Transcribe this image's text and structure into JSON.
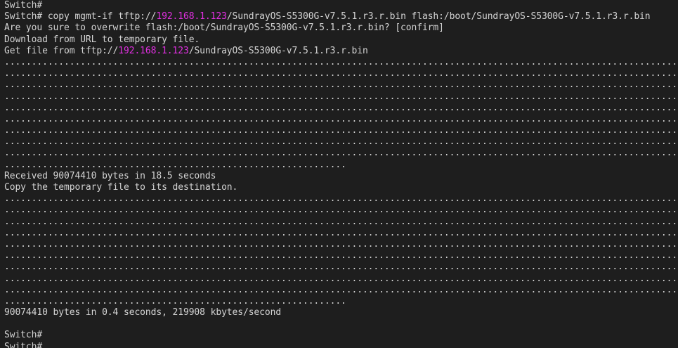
{
  "terminal": {
    "text_color": "#d4d4d4",
    "background_color": "#1e1e1e",
    "highlight_color": "#e22fe2",
    "lines": [
      [
        "Switch#"
      ],
      [
        "Switch# copy mgmt-if tftp://",
        {
          "hl": "192.168.1.123"
        },
        "/SundrayOS-S5300G-v7.5.1.r3.r.bin flash:/boot/SundrayOS-S5300G-v7.5.1.r3.r.bin"
      ],
      [
        "Are you sure to overwrite flash:/boot/SundrayOS-S5300G-v7.5.1.r3.r.bin? [confirm]"
      ],
      [
        "Download from URL to temporary file."
      ],
      [
        "Get file from tftp://",
        {
          "hl": "192.168.1.123"
        },
        "/SundrayOS-S5300G-v7.5.1.r3.r.bin"
      ],
      [
        "................................................................................................................................................................"
      ],
      [
        "................................................................................................................................................................"
      ],
      [
        "................................................................................................................................................................"
      ],
      [
        "................................................................................................................................................................"
      ],
      [
        "................................................................................................................................................................"
      ],
      [
        "................................................................................................................................................................"
      ],
      [
        "................................................................................................................................................................"
      ],
      [
        "................................................................................................................................................................"
      ],
      [
        "................................................................................................................................................................"
      ],
      [
        "..............................................................."
      ],
      [
        "Received 90074410 bytes in 18.5 seconds"
      ],
      [
        "Copy the temporary file to its destination."
      ],
      [
        "................................................................................................................................................................"
      ],
      [
        "................................................................................................................................................................"
      ],
      [
        "................................................................................................................................................................"
      ],
      [
        "................................................................................................................................................................"
      ],
      [
        "................................................................................................................................................................"
      ],
      [
        "................................................................................................................................................................"
      ],
      [
        "................................................................................................................................................................"
      ],
      [
        "................................................................................................................................................................"
      ],
      [
        "................................................................................................................................................................"
      ],
      [
        "..............................................................."
      ],
      [
        "90074410 bytes in 0.4 seconds, 219908 kbytes/second"
      ],
      [
        ""
      ],
      [
        "Switch#"
      ],
      [
        "Switch#"
      ]
    ]
  }
}
